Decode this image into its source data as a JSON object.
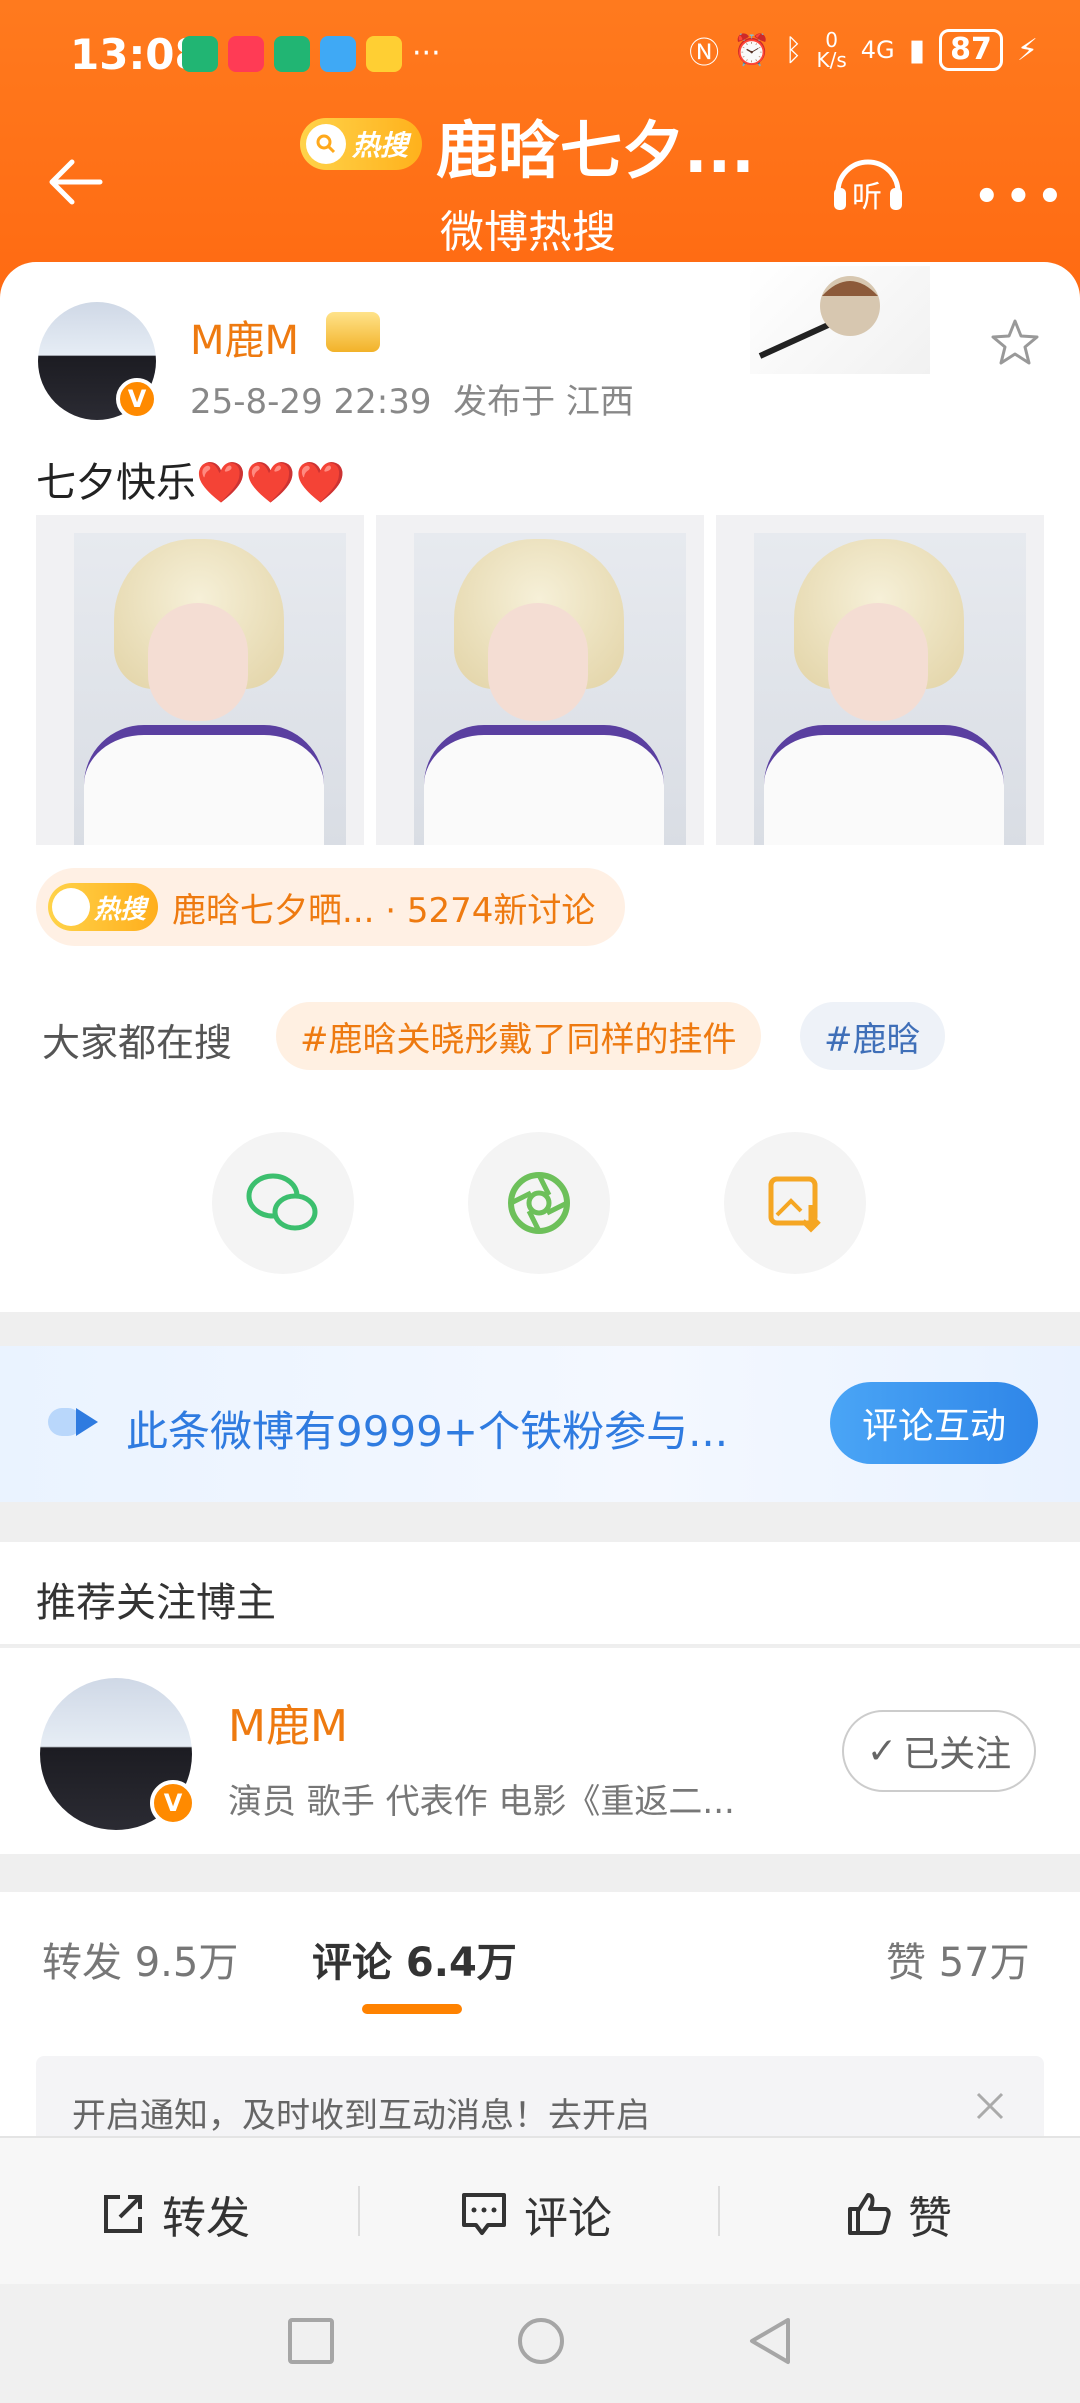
{
  "status_bar": {
    "time": "13:08",
    "app_icons": "···",
    "net_speed_top": "0",
    "net_speed_bottom": "K/s",
    "signal": "4G",
    "battery": "87"
  },
  "header": {
    "badge": "热搜",
    "title": "鹿晗七夕...",
    "subtitle": "微博热搜",
    "listen_label": "听"
  },
  "post": {
    "author": "M鹿M",
    "verified_badge": "V",
    "datetime": "25-8-29 22:39",
    "location": "发布于 江西",
    "text": "七夕快乐",
    "hearts": "❤️❤️❤️",
    "hot_topic": {
      "badge": "热搜",
      "text": "鹿晗七夕晒... · 5274新讨论"
    },
    "search": {
      "label": "大家都在搜",
      "chips": [
        "#鹿晗关晓彤戴了同样的挂件",
        "#鹿晗"
      ]
    }
  },
  "fans_band": {
    "text": "此条微博有9999+个铁粉参与...",
    "button": "评论互动"
  },
  "recommend": {
    "title": "推荐关注博主",
    "name": "M鹿M",
    "desc": "演员 歌手 代表作 电影《重返二...",
    "follow_button": "已关注"
  },
  "tabs": {
    "repost": "转发 9.5万",
    "comment": "评论 6.4万",
    "like": "赞 57万"
  },
  "notice": {
    "text": "开启通知，及时收到互动消息！去开启"
  },
  "actions": {
    "repost": "转发",
    "comment": "评论",
    "like": "赞"
  },
  "colors": {
    "brand_orange": "#ff7a1e",
    "name_orange": "#ee7a10",
    "link_blue": "#2f7be0"
  }
}
